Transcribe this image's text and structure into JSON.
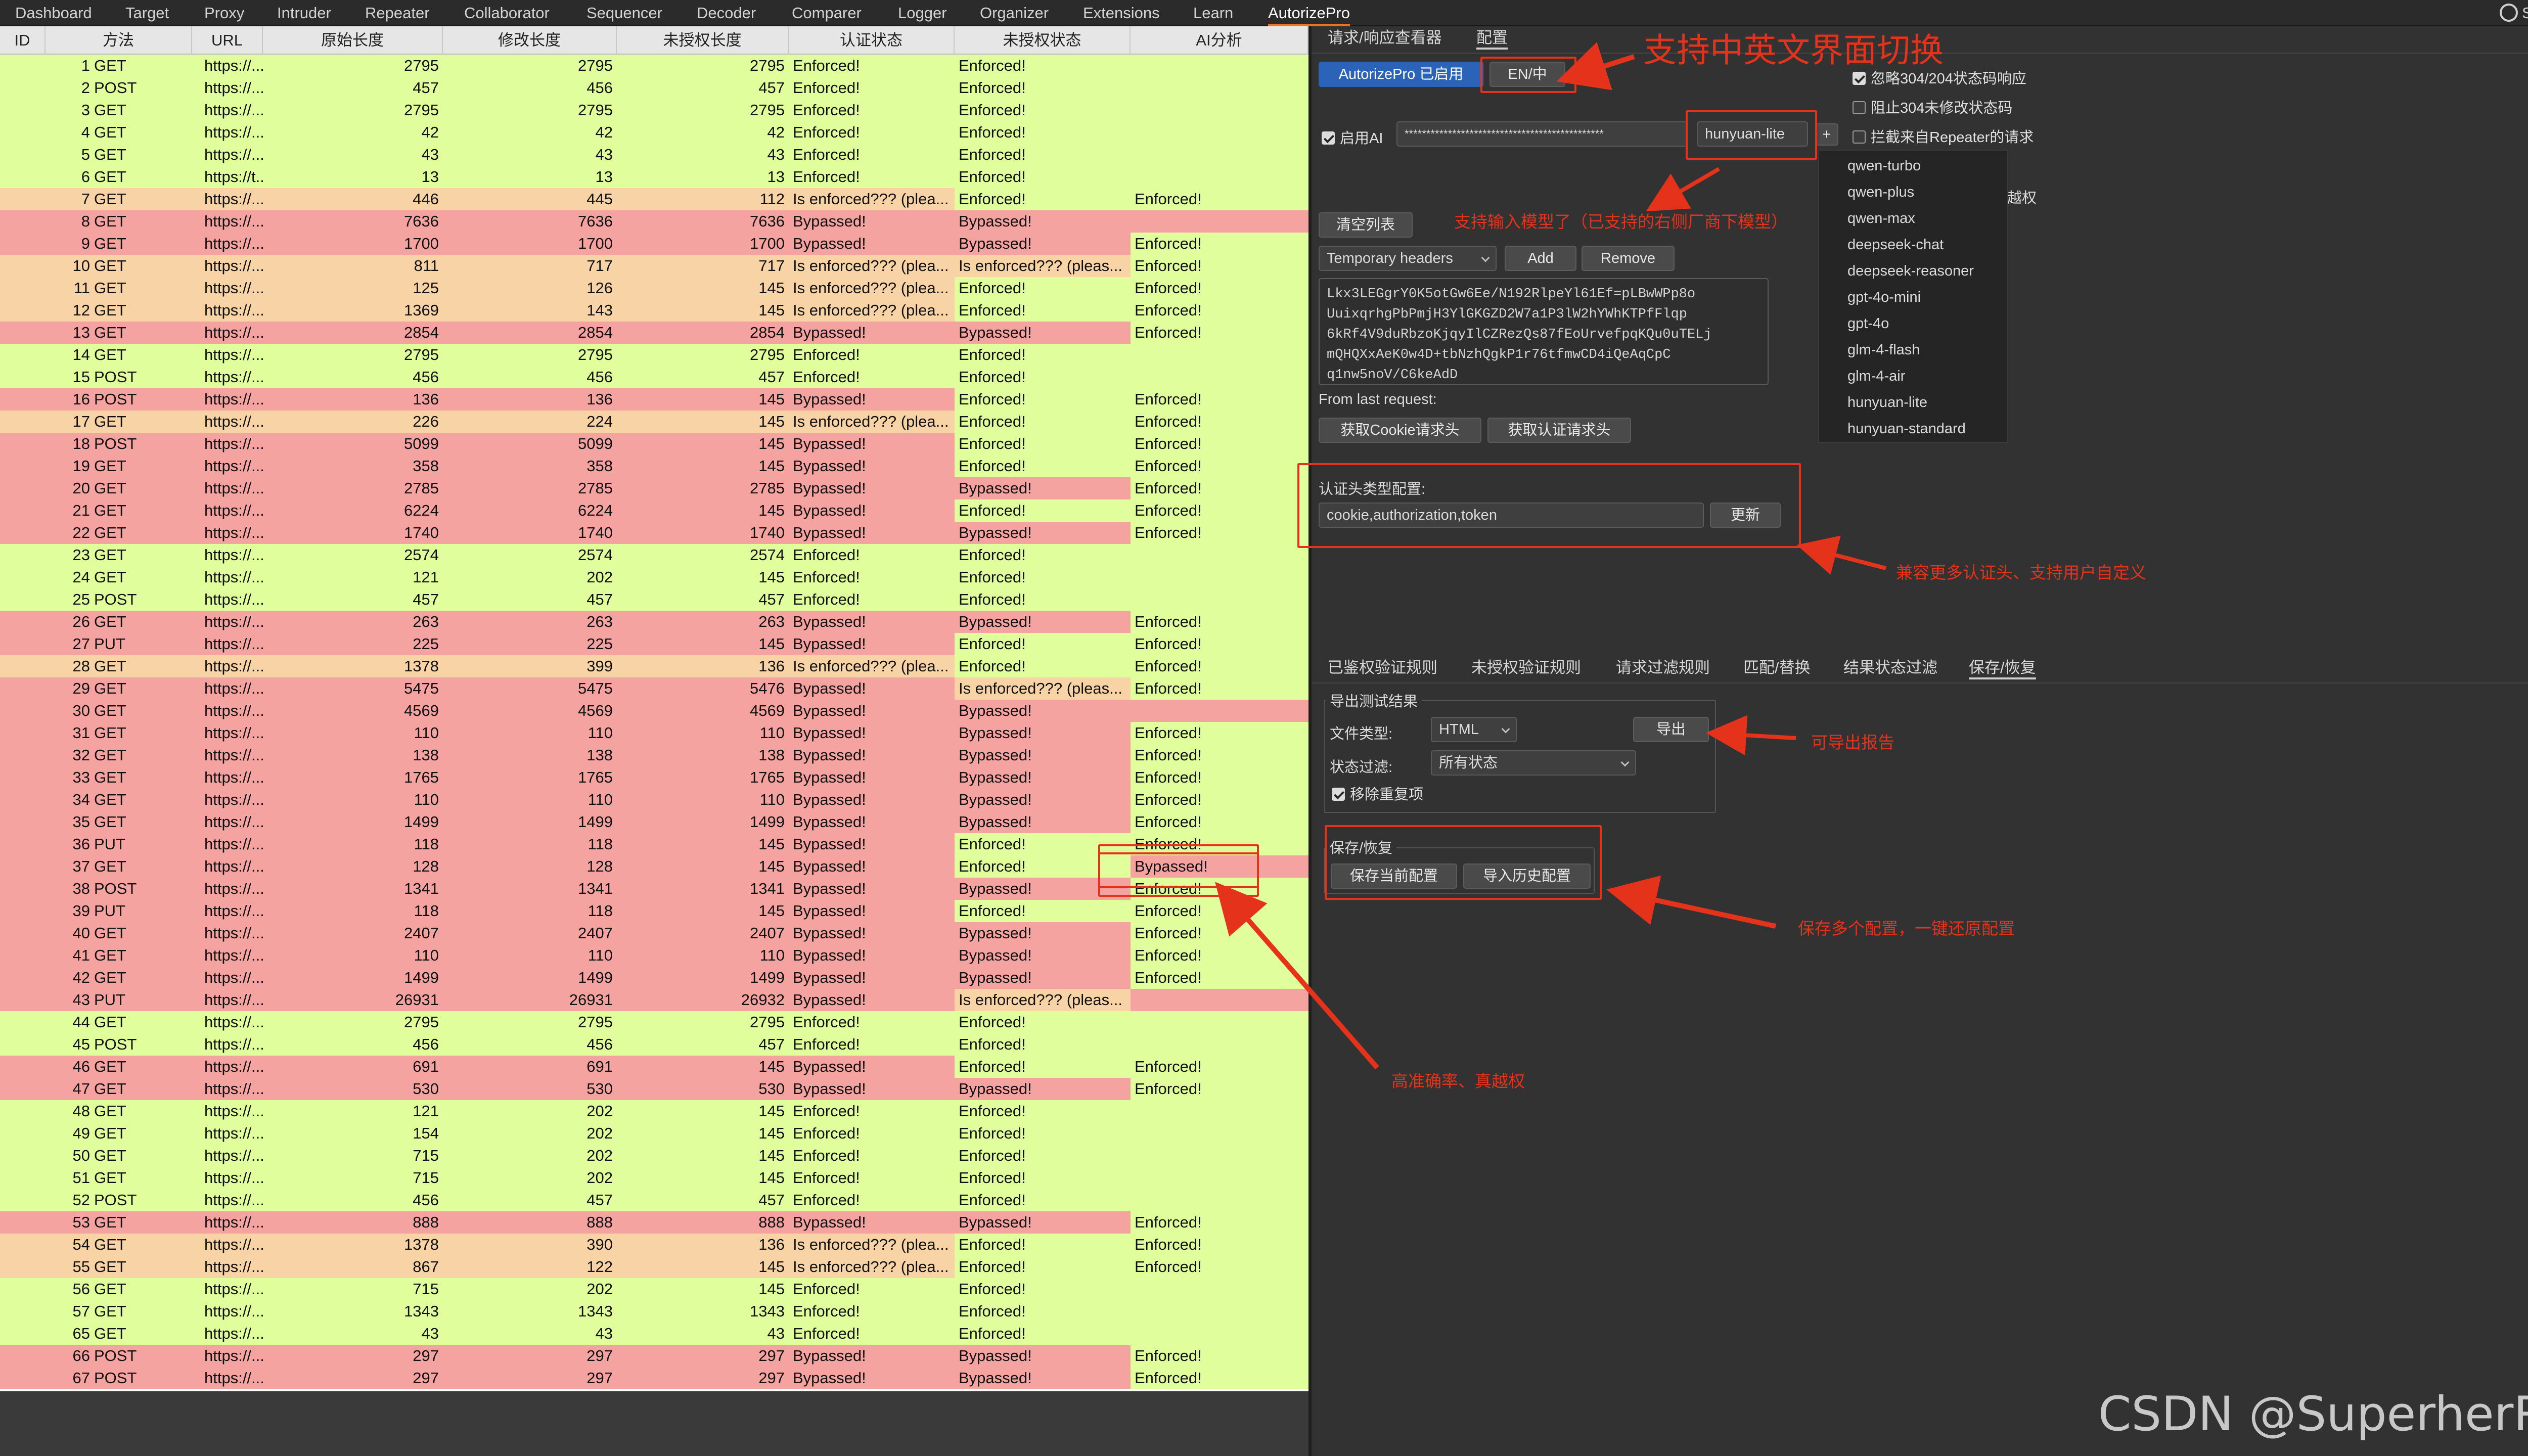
{
  "menubar": {
    "items": [
      "Dashboard",
      "Target",
      "Proxy",
      "Intruder",
      "Repeater",
      "Collaborator",
      "Sequencer",
      "Decoder",
      "Comparer",
      "Logger",
      "Organizer",
      "Extensions",
      "Learn",
      "AutorizePro"
    ],
    "active": "AutorizePro",
    "settings_label": "Settings"
  },
  "table": {
    "columns": [
      "ID",
      "方法",
      "URL",
      "原始长度",
      "修改长度",
      "未授权长度",
      "认证状态",
      "未授权状态",
      "AI分析"
    ],
    "rows": [
      [
        "1",
        "GET",
        "https://...",
        "2795",
        "2795",
        "2795",
        "Enforced!",
        "Enforced!",
        ""
      ],
      [
        "2",
        "POST",
        "https://...",
        "457",
        "456",
        "457",
        "Enforced!",
        "Enforced!",
        ""
      ],
      [
        "3",
        "GET",
        "https://...",
        "2795",
        "2795",
        "2795",
        "Enforced!",
        "Enforced!",
        ""
      ],
      [
        "4",
        "GET",
        "https://...",
        "42",
        "42",
        "42",
        "Enforced!",
        "Enforced!",
        ""
      ],
      [
        "5",
        "GET",
        "https://...",
        "43",
        "43",
        "43",
        "Enforced!",
        "Enforced!",
        ""
      ],
      [
        "6",
        "GET",
        "https://t...",
        "13",
        "13",
        "13",
        "Enforced!",
        "Enforced!",
        ""
      ],
      [
        "7",
        "GET",
        "https://...",
        "446",
        "445",
        "112",
        "Is enforced??? (plea...",
        "Enforced!",
        "Enforced!"
      ],
      [
        "8",
        "GET",
        "https://...",
        "7636",
        "7636",
        "7636",
        "Bypassed!",
        "Bypassed!",
        ""
      ],
      [
        "9",
        "GET",
        "https://...",
        "1700",
        "1700",
        "1700",
        "Bypassed!",
        "Bypassed!",
        "Enforced!"
      ],
      [
        "10",
        "GET",
        "https://...",
        "811",
        "717",
        "717",
        "Is enforced??? (plea...",
        "Is enforced??? (pleas...",
        "Enforced!"
      ],
      [
        "11",
        "GET",
        "https://...",
        "125",
        "126",
        "145",
        "Is enforced??? (plea...",
        "Enforced!",
        "Enforced!"
      ],
      [
        "12",
        "GET",
        "https://...",
        "1369",
        "143",
        "145",
        "Is enforced??? (plea...",
        "Enforced!",
        "Enforced!"
      ],
      [
        "13",
        "GET",
        "https://...",
        "2854",
        "2854",
        "2854",
        "Bypassed!",
        "Bypassed!",
        "Enforced!"
      ],
      [
        "14",
        "GET",
        "https://...",
        "2795",
        "2795",
        "2795",
        "Enforced!",
        "Enforced!",
        ""
      ],
      [
        "15",
        "POST",
        "https://...",
        "456",
        "456",
        "457",
        "Enforced!",
        "Enforced!",
        ""
      ],
      [
        "16",
        "POST",
        "https://...",
        "136",
        "136",
        "145",
        "Bypassed!",
        "Enforced!",
        "Enforced!"
      ],
      [
        "17",
        "GET",
        "https://...",
        "226",
        "224",
        "145",
        "Is enforced??? (plea...",
        "Enforced!",
        "Enforced!"
      ],
      [
        "18",
        "POST",
        "https://...",
        "5099",
        "5099",
        "145",
        "Bypassed!",
        "Enforced!",
        "Enforced!"
      ],
      [
        "19",
        "GET",
        "https://...",
        "358",
        "358",
        "145",
        "Bypassed!",
        "Enforced!",
        "Enforced!"
      ],
      [
        "20",
        "GET",
        "https://...",
        "2785",
        "2785",
        "2785",
        "Bypassed!",
        "Bypassed!",
        "Enforced!"
      ],
      [
        "21",
        "GET",
        "https://...",
        "6224",
        "6224",
        "145",
        "Bypassed!",
        "Enforced!",
        "Enforced!"
      ],
      [
        "22",
        "GET",
        "https://...",
        "1740",
        "1740",
        "1740",
        "Bypassed!",
        "Bypassed!",
        "Enforced!"
      ],
      [
        "23",
        "GET",
        "https://...",
        "2574",
        "2574",
        "2574",
        "Enforced!",
        "Enforced!",
        ""
      ],
      [
        "24",
        "GET",
        "https://...",
        "121",
        "202",
        "145",
        "Enforced!",
        "Enforced!",
        ""
      ],
      [
        "25",
        "POST",
        "https://...",
        "457",
        "457",
        "457",
        "Enforced!",
        "Enforced!",
        ""
      ],
      [
        "26",
        "GET",
        "https://...",
        "263",
        "263",
        "263",
        "Bypassed!",
        "Bypassed!",
        "Enforced!"
      ],
      [
        "27",
        "PUT",
        "https://...",
        "225",
        "225",
        "145",
        "Bypassed!",
        "Enforced!",
        "Enforced!"
      ],
      [
        "28",
        "GET",
        "https://...",
        "1378",
        "399",
        "136",
        "Is enforced??? (plea...",
        "Enforced!",
        "Enforced!"
      ],
      [
        "29",
        "GET",
        "https://...",
        "5475",
        "5475",
        "5476",
        "Bypassed!",
        "Is enforced??? (pleas...",
        "Enforced!"
      ],
      [
        "30",
        "GET",
        "https://...",
        "4569",
        "4569",
        "4569",
        "Bypassed!",
        "Bypassed!",
        ""
      ],
      [
        "31",
        "GET",
        "https://...",
        "110",
        "110",
        "110",
        "Bypassed!",
        "Bypassed!",
        "Enforced!"
      ],
      [
        "32",
        "GET",
        "https://...",
        "138",
        "138",
        "138",
        "Bypassed!",
        "Bypassed!",
        "Enforced!"
      ],
      [
        "33",
        "GET",
        "https://...",
        "1765",
        "1765",
        "1765",
        "Bypassed!",
        "Bypassed!",
        "Enforced!"
      ],
      [
        "34",
        "GET",
        "https://...",
        "110",
        "110",
        "110",
        "Bypassed!",
        "Bypassed!",
        "Enforced!"
      ],
      [
        "35",
        "GET",
        "https://...",
        "1499",
        "1499",
        "1499",
        "Bypassed!",
        "Bypassed!",
        "Enforced!"
      ],
      [
        "36",
        "PUT",
        "https://...",
        "118",
        "118",
        "145",
        "Bypassed!",
        "Enforced!",
        "Enforced!"
      ],
      [
        "37",
        "GET",
        "https://...",
        "128",
        "128",
        "145",
        "Bypassed!",
        "Enforced!",
        "Bypassed!"
      ],
      [
        "38",
        "POST",
        "https://...",
        "1341",
        "1341",
        "1341",
        "Bypassed!",
        "Bypassed!",
        "Enforced!"
      ],
      [
        "39",
        "PUT",
        "https://...",
        "118",
        "118",
        "145",
        "Bypassed!",
        "Enforced!",
        "Enforced!"
      ],
      [
        "40",
        "GET",
        "https://...",
        "2407",
        "2407",
        "2407",
        "Bypassed!",
        "Bypassed!",
        "Enforced!"
      ],
      [
        "41",
        "GET",
        "https://...",
        "110",
        "110",
        "110",
        "Bypassed!",
        "Bypassed!",
        "Enforced!"
      ],
      [
        "42",
        "GET",
        "https://...",
        "1499",
        "1499",
        "1499",
        "Bypassed!",
        "Bypassed!",
        "Enforced!"
      ],
      [
        "43",
        "PUT",
        "https://...",
        "26931",
        "26931",
        "26932",
        "Bypassed!",
        "Is enforced??? (pleas...",
        ""
      ],
      [
        "44",
        "GET",
        "https://...",
        "2795",
        "2795",
        "2795",
        "Enforced!",
        "Enforced!",
        ""
      ],
      [
        "45",
        "POST",
        "https://...",
        "456",
        "456",
        "457",
        "Enforced!",
        "Enforced!",
        ""
      ],
      [
        "46",
        "GET",
        "https://...",
        "691",
        "691",
        "145",
        "Bypassed!",
        "Enforced!",
        "Enforced!"
      ],
      [
        "47",
        "GET",
        "https://...",
        "530",
        "530",
        "530",
        "Bypassed!",
        "Bypassed!",
        "Enforced!"
      ],
      [
        "48",
        "GET",
        "https://...",
        "121",
        "202",
        "145",
        "Enforced!",
        "Enforced!",
        ""
      ],
      [
        "49",
        "GET",
        "https://...",
        "154",
        "202",
        "145",
        "Enforced!",
        "Enforced!",
        ""
      ],
      [
        "50",
        "GET",
        "https://...",
        "715",
        "202",
        "145",
        "Enforced!",
        "Enforced!",
        ""
      ],
      [
        "51",
        "GET",
        "https://...",
        "715",
        "202",
        "145",
        "Enforced!",
        "Enforced!",
        ""
      ],
      [
        "52",
        "POST",
        "https://...",
        "456",
        "457",
        "457",
        "Enforced!",
        "Enforced!",
        ""
      ],
      [
        "53",
        "GET",
        "https://...",
        "888",
        "888",
        "888",
        "Bypassed!",
        "Bypassed!",
        "Enforced!"
      ],
      [
        "54",
        "GET",
        "https://...",
        "1378",
        "390",
        "136",
        "Is enforced??? (plea...",
        "Enforced!",
        "Enforced!"
      ],
      [
        "55",
        "GET",
        "https://...",
        "867",
        "122",
        "145",
        "Is enforced??? (plea...",
        "Enforced!",
        "Enforced!"
      ],
      [
        "56",
        "GET",
        "https://...",
        "715",
        "202",
        "145",
        "Enforced!",
        "Enforced!",
        ""
      ],
      [
        "57",
        "GET",
        "https://...",
        "1343",
        "1343",
        "1343",
        "Enforced!",
        "Enforced!",
        ""
      ],
      [
        "65",
        "GET",
        "https://...",
        "43",
        "43",
        "43",
        "Enforced!",
        "Enforced!",
        ""
      ],
      [
        "66",
        "POST",
        "https://...",
        "297",
        "297",
        "297",
        "Bypassed!",
        "Bypassed!",
        "Enforced!"
      ],
      [
        "67",
        "POST",
        "https://...",
        "297",
        "297",
        "297",
        "Bypassed!",
        "Bypassed!",
        "Enforced!"
      ]
    ]
  },
  "status_colors": {
    "enforced": "#e0ff9c",
    "bypassed": "#f4a3a1",
    "is_enforced": "#f8d3a6"
  },
  "panel": {
    "tabs": [
      "请求/响应查看器",
      "配置"
    ],
    "selected_tab": "配置",
    "toggle_button": "AutorizePro 已启用",
    "lang_button": "EN/中",
    "ignore_304_label": "忽略304/204状态码响应",
    "block_304_label": "阻止304未修改状态码",
    "intercept_repeater_label": "拦截来自Repeater的请求",
    "partial_label": "越权",
    "enable_ai_label": "启用AI",
    "api_key_masked": "**********************************************",
    "model_value": "hunyuan-lite",
    "plus_label": "+",
    "models": [
      "qwen-turbo",
      "qwen-plus",
      "qwen-max",
      "deepseek-chat",
      "deepseek-reasoner",
      "gpt-4o-mini",
      "gpt-4o",
      "glm-4-flash",
      "glm-4-air",
      "hunyuan-lite",
      "hunyuan-standard"
    ],
    "clear_button": "清空列表",
    "headers_select": "Temporary headers",
    "add_button": "Add",
    "remove_button": "Remove",
    "headers_text": [
      "Lkx3LEGgrY0K5otGw6Ee/N192RlpeYl61Ef=pLBwWPp8o",
      "UuixqrhgPbPmjH3YlGKGZD2W7a1P3lW2hYWhKTPfFlqp",
      "6kRf4V9duRbzoKjqyIlCZRezQs87fEoUrvefpqKQu0uTELj",
      "mQHQXxAeK0w4D+tbNzhQgkP1r76tfmwCD4iQeAqCpC",
      "q1nw5noV/C6keAdD"
    ],
    "from_last_request": "From last request:",
    "get_cookie_button": "获取Cookie请求头",
    "get_auth_button": "获取认证请求头",
    "auth_config_label": "认证头类型配置:",
    "auth_config_value": "cookie,authorization,token",
    "update_button": "更新",
    "tabs2": [
      "已鉴权验证规则",
      "未授权验证规则",
      "请求过滤规则",
      "匹配/替换",
      "结果状态过滤",
      "保存/恢复"
    ],
    "selected_tab2": "保存/恢复",
    "export_legend": "导出测试结果",
    "file_type_label": "文件类型:",
    "file_type_value": "HTML",
    "export_button": "导出",
    "status_filter_label": "状态过滤:",
    "status_filter_value": "所有状态",
    "dedupe_label": "移除重复项",
    "save_legend": "保存/恢复",
    "save_config_button": "保存当前配置",
    "import_config_button": "导入历史配置"
  },
  "annotations": {
    "lang_switch": "支持中英文界面切换",
    "model_input": "支持输入模型了（已支持的右侧厂商下模型）",
    "auth_header": "兼容更多认证头、支持用户自定义",
    "export": "可导出报告",
    "save_config": "保存多个配置，一键还原配置",
    "accuracy": "高准确率、真越权"
  },
  "watermark": "CSDN @SuperherRo"
}
